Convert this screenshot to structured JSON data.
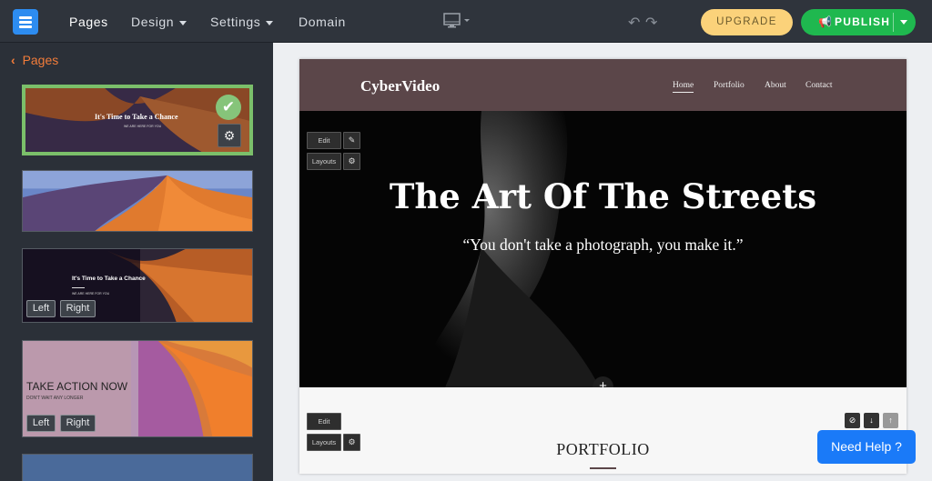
{
  "topbar": {
    "logo_icon": "pages-logo-icon",
    "nav": [
      {
        "label": "Pages",
        "has_caret": false
      },
      {
        "label": "Design",
        "has_caret": true
      },
      {
        "label": "Settings",
        "has_caret": true
      },
      {
        "label": "Domain",
        "has_caret": false
      }
    ],
    "device_icon": "desktop-monitor-icon",
    "upgrade_label": "UPGRADE",
    "publish_label": "PUBLISH",
    "colors": {
      "upgrade": "#fbd27a",
      "publish": "#1fb84f",
      "accent": "#2d8cf0"
    }
  },
  "sidebar": {
    "back_label": "Pages",
    "thumbnails": [
      {
        "title": "It's Time to Take a Chance",
        "subtitle": "WE ARE HERE FOR YOU",
        "selected": true
      },
      {
        "title": "",
        "subtitle": "",
        "selected": false
      },
      {
        "title": "It's Time to Take a Chance",
        "subtitle": "WE ARE HERE FOR YOU",
        "selected": false,
        "left_label": "Left",
        "right_label": "Right"
      },
      {
        "title": "TAKE ACTION NOW",
        "subtitle": "DON'T WAIT ANY LONGER",
        "selected": false,
        "left_label": "Left",
        "right_label": "Right"
      }
    ]
  },
  "site": {
    "brand": "CyberVideo",
    "menu": [
      "Home",
      "Portfolio",
      "About",
      "Contact"
    ],
    "hero_title": "The Art Of The Streets",
    "hero_quote": "“You don't take a photograph, you make it.”",
    "edit_label": "Edit",
    "layouts_label": "Layouts",
    "section_title": "PORTFOLIO",
    "header_color": "#5b4649"
  },
  "help": {
    "label": "Need Help ?"
  }
}
